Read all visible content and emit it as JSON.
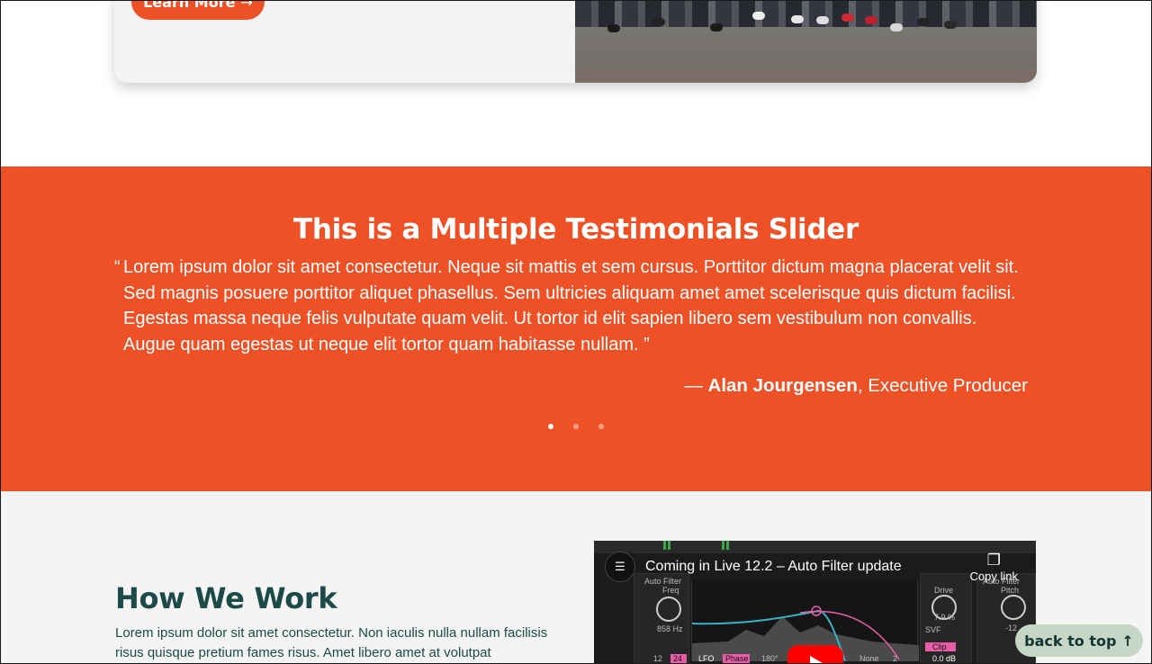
{
  "top_card": {
    "learn_more_label": "Learn More",
    "arrow_icon": "→"
  },
  "testimonials": {
    "title": "This is a Multiple Testimonials Slider",
    "quote_open": "“",
    "quote": "Lorem ipsum dolor sit amet consectetur. Neque sit mattis et sem cursus. Porttitor dictum magna placerat velit sit. Sed magnis posuere porttitor aliquet phasellus. Sem ultricies aliquam amet amet scelerisque quis dictum facilisi. Egestas massa neque felis vulputate quam velit. Ut tortor id elit sapien libero sem vestibulum non convallis. Augue quam egestas ut neque elit tortor quam habitasse nullam. ”",
    "attribution_dash": "— ",
    "attribution_name": "Alan Jourgensen",
    "attribution_role": ", Executive Producer",
    "active_slide": 1,
    "slide_count": 3
  },
  "how_we_work": {
    "title": "How We Work",
    "text": "Lorem ipsum dolor sit amet consectetur. Non iaculis nulla nullam facilisis risus quisque pretium fames risus. Amet libero amet at volutpat"
  },
  "video": {
    "title": "Coming in Live 12.2 – Auto Filter update",
    "copy_link_label": "Copy link",
    "copy_icon": "copy-icon",
    "play_icon": "youtube-play-icon",
    "labels": {
      "auto_filter": "Auto Filter",
      "freq": "Freq",
      "freq_value": "858 Hz",
      "drive": "Drive",
      "drive_value": "7.9 %",
      "svf": "SVF",
      "clip": "Clip",
      "db": "0.0 dB",
      "lfo": "LFO",
      "phase": "Phase",
      "deg": "180°",
      "none": "None",
      "n12": "12",
      "n24": "24",
      "n2": "2",
      "pitch": "Pitch",
      "m12": "-12"
    }
  },
  "back_to_top": {
    "label": "back to top",
    "arrow_icon": "↑"
  },
  "colors": {
    "brand_orange": "#ee5126",
    "dark_teal": "#1c4a48",
    "mint": "#c6d7c6"
  }
}
